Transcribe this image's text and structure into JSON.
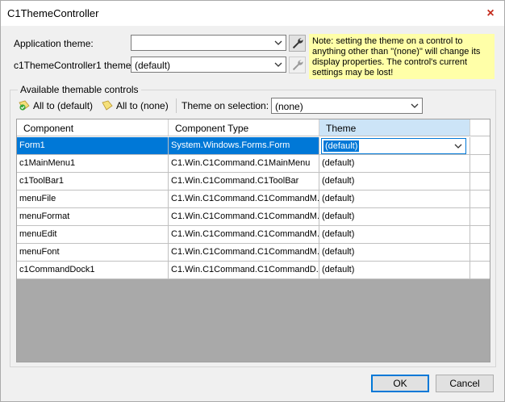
{
  "window": {
    "title": "C1ThemeController",
    "close_glyph": "×"
  },
  "settings": {
    "app_theme_label": "Application theme:",
    "app_theme_value": "",
    "controller_theme_label": "c1ThemeController1 theme:",
    "controller_theme_value": "(default)"
  },
  "note": "Note: setting the theme on a control to anything other than \"(none)\" will change its display properties. The control's current settings may be lost!",
  "group": {
    "title": "Available themable controls"
  },
  "toolbar": {
    "all_default_label": "All to (default)",
    "all_none_label": "All to (none)",
    "theme_on_selection_label": "Theme on selection:",
    "theme_on_selection_value": "(none)"
  },
  "grid": {
    "columns": [
      "Component",
      "Component Type",
      "Theme"
    ],
    "rows": [
      [
        "Form1",
        "System.Windows.Forms.Form",
        "(default)"
      ],
      [
        "c1MainMenu1",
        "C1.Win.C1Command.C1MainMenu",
        "(default)"
      ],
      [
        "c1ToolBar1",
        "C1.Win.C1Command.C1ToolBar",
        "(default)"
      ],
      [
        "menuFile",
        "C1.Win.C1Command.C1CommandM...",
        "(default)"
      ],
      [
        "menuFormat",
        "C1.Win.C1Command.C1CommandM...",
        "(default)"
      ],
      [
        "menuEdit",
        "C1.Win.C1Command.C1CommandM...",
        "(default)"
      ],
      [
        "menuFont",
        "C1.Win.C1Command.C1CommandM...",
        "(default)"
      ],
      [
        "c1CommandDock1",
        "C1.Win.C1Command.C1CommandD...",
        "(default)"
      ]
    ],
    "selected_row": 0
  },
  "buttons": {
    "ok": "OK",
    "cancel": "Cancel"
  },
  "colors": {
    "selection": "#0078d7",
    "note_bg": "#ffffa8",
    "grid_empty": "#a9a9a9",
    "close": "#c42b1c"
  }
}
